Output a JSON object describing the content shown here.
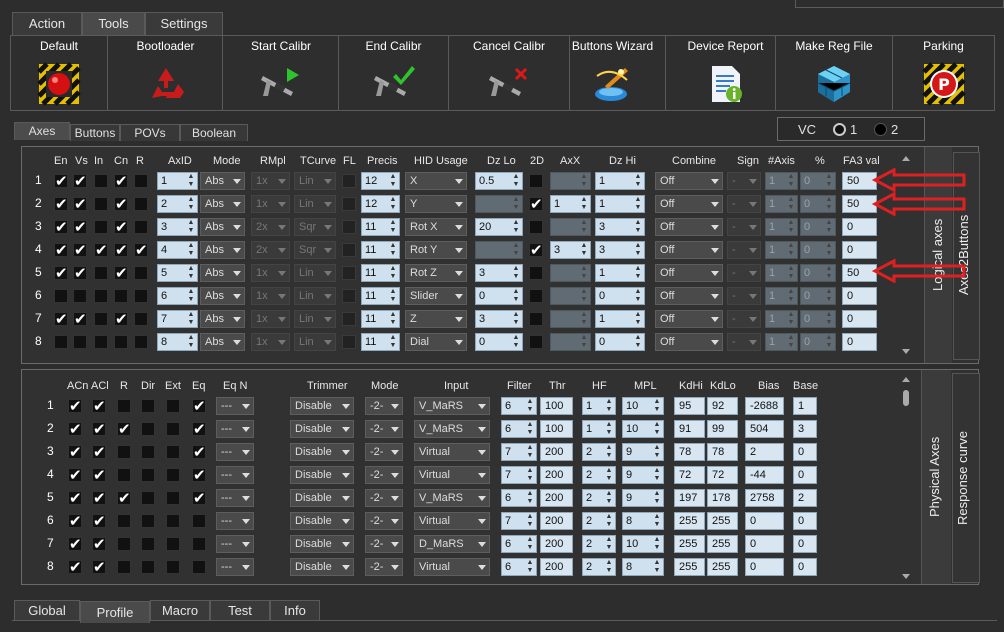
{
  "top_tabs": [
    "Action",
    "Tools",
    "Settings"
  ],
  "toolbar": [
    {
      "label": "Default",
      "icon": "red-ball-icon"
    },
    {
      "label": "Bootloader",
      "icon": "recycle-icon"
    },
    {
      "label": "Start Calibr",
      "icon": "caliper-play-icon"
    },
    {
      "label": "End Calibr",
      "icon": "caliper-check-icon"
    },
    {
      "label": "Cancel Calibr",
      "icon": "caliper-cancel-icon"
    },
    {
      "label": "Buttons Wizard",
      "icon": "wizard-icon"
    },
    {
      "label": "Device Report",
      "icon": "report-icon"
    },
    {
      "label": "Make Reg File",
      "icon": "cube-icon"
    },
    {
      "label": "Parking",
      "icon": "parking-icon"
    }
  ],
  "sub_tabs": [
    "Axes",
    "Buttons",
    "POVs",
    "Boolean"
  ],
  "vc": {
    "label": "VC",
    "opt1": "1",
    "opt2": "2"
  },
  "logical": {
    "headers": [
      "En",
      "Vs",
      "In",
      "Cn",
      "R",
      "AxID",
      "Mode",
      "RMpl",
      "TCurve",
      "FL",
      "Precis",
      "HID Usage",
      "Dz Lo",
      "2D",
      "AxX",
      "Dz Hi",
      "Combine",
      "Sign",
      "#Axis",
      "%",
      "FA3 val"
    ],
    "side1": "Logical axes",
    "side2": "Axes2Buttons",
    "rows": [
      {
        "n": "1",
        "en": 1,
        "vs": 1,
        "in": 0,
        "cn": 1,
        "r": 0,
        "axid": "1",
        "mode": "Abs",
        "rmpl": "1x",
        "tcurve": "Lin",
        "precis": "12",
        "hid": "X",
        "dzlo": "0.5",
        "d2": 0,
        "axx": "",
        "dzhi": "1",
        "combine": "Off",
        "sign": "-",
        "naxis": "1",
        "pct": "0",
        "fa3": "50"
      },
      {
        "n": "2",
        "en": 1,
        "vs": 1,
        "in": 0,
        "cn": 1,
        "r": 0,
        "axid": "2",
        "mode": "Abs",
        "rmpl": "1x",
        "tcurve": "Lin",
        "precis": "12",
        "hid": "Y",
        "dzlo": "",
        "d2": 1,
        "axx": "1",
        "dzhi": "1",
        "combine": "Off",
        "sign": "-",
        "naxis": "1",
        "pct": "0",
        "fa3": "50"
      },
      {
        "n": "3",
        "en": 1,
        "vs": 1,
        "in": 0,
        "cn": 1,
        "r": 0,
        "axid": "3",
        "mode": "Abs",
        "rmpl": "2x",
        "tcurve": "Sqr",
        "precis": "11",
        "hid": "Rot X",
        "dzlo": "20",
        "d2": 0,
        "axx": "",
        "dzhi": "3",
        "combine": "Off",
        "sign": "-",
        "naxis": "1",
        "pct": "0",
        "fa3": "0"
      },
      {
        "n": "4",
        "en": 1,
        "vs": 1,
        "in": 1,
        "cn": 1,
        "r": 1,
        "axid": "4",
        "mode": "Abs",
        "rmpl": "2x",
        "tcurve": "Sqr",
        "precis": "11",
        "hid": "Rot Y",
        "dzlo": "",
        "d2": 1,
        "axx": "3",
        "dzhi": "3",
        "combine": "Off",
        "sign": "-",
        "naxis": "1",
        "pct": "0",
        "fa3": "0"
      },
      {
        "n": "5",
        "en": 1,
        "vs": 1,
        "in": 0,
        "cn": 1,
        "r": 0,
        "axid": "5",
        "mode": "Abs",
        "rmpl": "1x",
        "tcurve": "Lin",
        "precis": "11",
        "hid": "Rot Z",
        "dzlo": "3",
        "d2": 0,
        "axx": "",
        "dzhi": "1",
        "combine": "Off",
        "sign": "-",
        "naxis": "1",
        "pct": "0",
        "fa3": "50"
      },
      {
        "n": "6",
        "en": 0,
        "vs": 0,
        "in": 0,
        "cn": 0,
        "r": 0,
        "axid": "6",
        "mode": "Abs",
        "rmpl": "1x",
        "tcurve": "Lin",
        "precis": "11",
        "hid": "Slider",
        "dzlo": "0",
        "d2": 0,
        "axx": "",
        "dzhi": "0",
        "combine": "Off",
        "sign": "-",
        "naxis": "1",
        "pct": "0",
        "fa3": "0"
      },
      {
        "n": "7",
        "en": 1,
        "vs": 1,
        "in": 0,
        "cn": 1,
        "r": 0,
        "axid": "7",
        "mode": "Abs",
        "rmpl": "1x",
        "tcurve": "Lin",
        "precis": "11",
        "hid": "Z",
        "dzlo": "3",
        "d2": 0,
        "axx": "",
        "dzhi": "1",
        "combine": "Off",
        "sign": "-",
        "naxis": "1",
        "pct": "0",
        "fa3": "0"
      },
      {
        "n": "8",
        "en": 0,
        "vs": 0,
        "in": 0,
        "cn": 0,
        "r": 0,
        "axid": "8",
        "mode": "Abs",
        "rmpl": "1x",
        "tcurve": "Lin",
        "precis": "11",
        "hid": "Dial",
        "dzlo": "0",
        "d2": 0,
        "axx": "",
        "dzhi": "0",
        "combine": "Off",
        "sign": "-",
        "naxis": "1",
        "pct": "0",
        "fa3": "0"
      }
    ]
  },
  "physical": {
    "headers": [
      "ACn",
      "ACl",
      "R",
      "Dir",
      "Ext",
      "Eq",
      "Eq N",
      "Trimmer",
      "Mode",
      "Input",
      "Filter",
      "Thr",
      "HF",
      "MPL",
      "KdHi",
      "KdLo",
      "Bias",
      "Base"
    ],
    "side1": "Physical Axes",
    "side2": "Response curve",
    "rows": [
      {
        "n": "1",
        "acn": 1,
        "acl": 1,
        "r": 0,
        "dir": 0,
        "ext": 0,
        "eq": 1,
        "eqn": "---",
        "trim": "Disable",
        "mode": "-2-",
        "input": "V_MaRS",
        "filter": "6",
        "thr": "100",
        "hf": "1",
        "mpl": "10",
        "kdhi": "95",
        "kdlo": "92",
        "bias": "-2688",
        "base": "1"
      },
      {
        "n": "2",
        "acn": 1,
        "acl": 1,
        "r": 1,
        "dir": 0,
        "ext": 0,
        "eq": 1,
        "eqn": "---",
        "trim": "Disable",
        "mode": "-2-",
        "input": "V_MaRS",
        "filter": "6",
        "thr": "100",
        "hf": "1",
        "mpl": "10",
        "kdhi": "91",
        "kdlo": "99",
        "bias": "504",
        "base": "3"
      },
      {
        "n": "3",
        "acn": 1,
        "acl": 1,
        "r": 0,
        "dir": 0,
        "ext": 0,
        "eq": 1,
        "eqn": "---",
        "trim": "Disable",
        "mode": "-2-",
        "input": "Virtual",
        "filter": "7",
        "thr": "200",
        "hf": "2",
        "mpl": "9",
        "kdhi": "78",
        "kdlo": "78",
        "bias": "2",
        "base": "0"
      },
      {
        "n": "4",
        "acn": 1,
        "acl": 1,
        "r": 0,
        "dir": 0,
        "ext": 0,
        "eq": 1,
        "eqn": "---",
        "trim": "Disable",
        "mode": "-2-",
        "input": "Virtual",
        "filter": "7",
        "thr": "200",
        "hf": "2",
        "mpl": "9",
        "kdhi": "72",
        "kdlo": "72",
        "bias": "-44",
        "base": "0"
      },
      {
        "n": "5",
        "acn": 1,
        "acl": 1,
        "r": 1,
        "dir": 0,
        "ext": 0,
        "eq": 1,
        "eqn": "---",
        "trim": "Disable",
        "mode": "-2-",
        "input": "V_MaRS",
        "filter": "6",
        "thr": "200",
        "hf": "2",
        "mpl": "9",
        "kdhi": "197",
        "kdlo": "178",
        "bias": "2758",
        "base": "2"
      },
      {
        "n": "6",
        "acn": 1,
        "acl": 1,
        "r": 0,
        "dir": 0,
        "ext": 0,
        "eq": 0,
        "eqn": "---",
        "trim": "Disable",
        "mode": "-2-",
        "input": "Virtual",
        "filter": "7",
        "thr": "200",
        "hf": "2",
        "mpl": "8",
        "kdhi": "255",
        "kdlo": "255",
        "bias": "0",
        "base": "0"
      },
      {
        "n": "7",
        "acn": 1,
        "acl": 1,
        "r": 0,
        "dir": 0,
        "ext": 0,
        "eq": 0,
        "eqn": "---",
        "trim": "Disable",
        "mode": "-2-",
        "input": "D_MaRS",
        "filter": "6",
        "thr": "200",
        "hf": "2",
        "mpl": "10",
        "kdhi": "255",
        "kdlo": "255",
        "bias": "0",
        "base": "0"
      },
      {
        "n": "8",
        "acn": 1,
        "acl": 1,
        "r": 0,
        "dir": 0,
        "ext": 0,
        "eq": 0,
        "eqn": "---",
        "trim": "Disable",
        "mode": "-2-",
        "input": "Virtual",
        "filter": "6",
        "thr": "200",
        "hf": "2",
        "mpl": "8",
        "kdhi": "255",
        "kdlo": "255",
        "bias": "0",
        "base": "0"
      }
    ]
  },
  "bottom_tabs": [
    "Global",
    "Profile",
    "Macro",
    "Test",
    "Info"
  ],
  "colors": {
    "annotation_arrow": "#e02020",
    "field_bg": "#cfe1ee"
  }
}
